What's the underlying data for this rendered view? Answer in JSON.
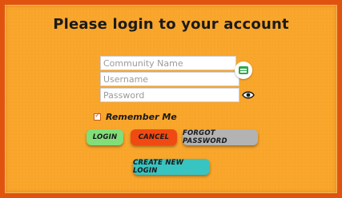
{
  "title": "Please login to your account",
  "form": {
    "community_placeholder": "Community Name",
    "username_placeholder": "Username",
    "password_placeholder": "Password",
    "community_value": "",
    "username_value": "",
    "password_value": "",
    "remember_label": "Remember Me",
    "remember_checked": true
  },
  "buttons": {
    "login": "LOGIN",
    "cancel": "CANCEL",
    "forgot": "FORGOT PASSWORD",
    "create": "CREATE NEW LOGIN"
  },
  "icons": {
    "autofill": "contact-card-icon",
    "reveal_password": "eye-icon"
  },
  "colors": {
    "background": "#f9a62b",
    "border": "#e0530f",
    "login": "#82de78",
    "cancel": "#f04a12",
    "forgot": "#b3b3b3",
    "create": "#38c4c1"
  }
}
